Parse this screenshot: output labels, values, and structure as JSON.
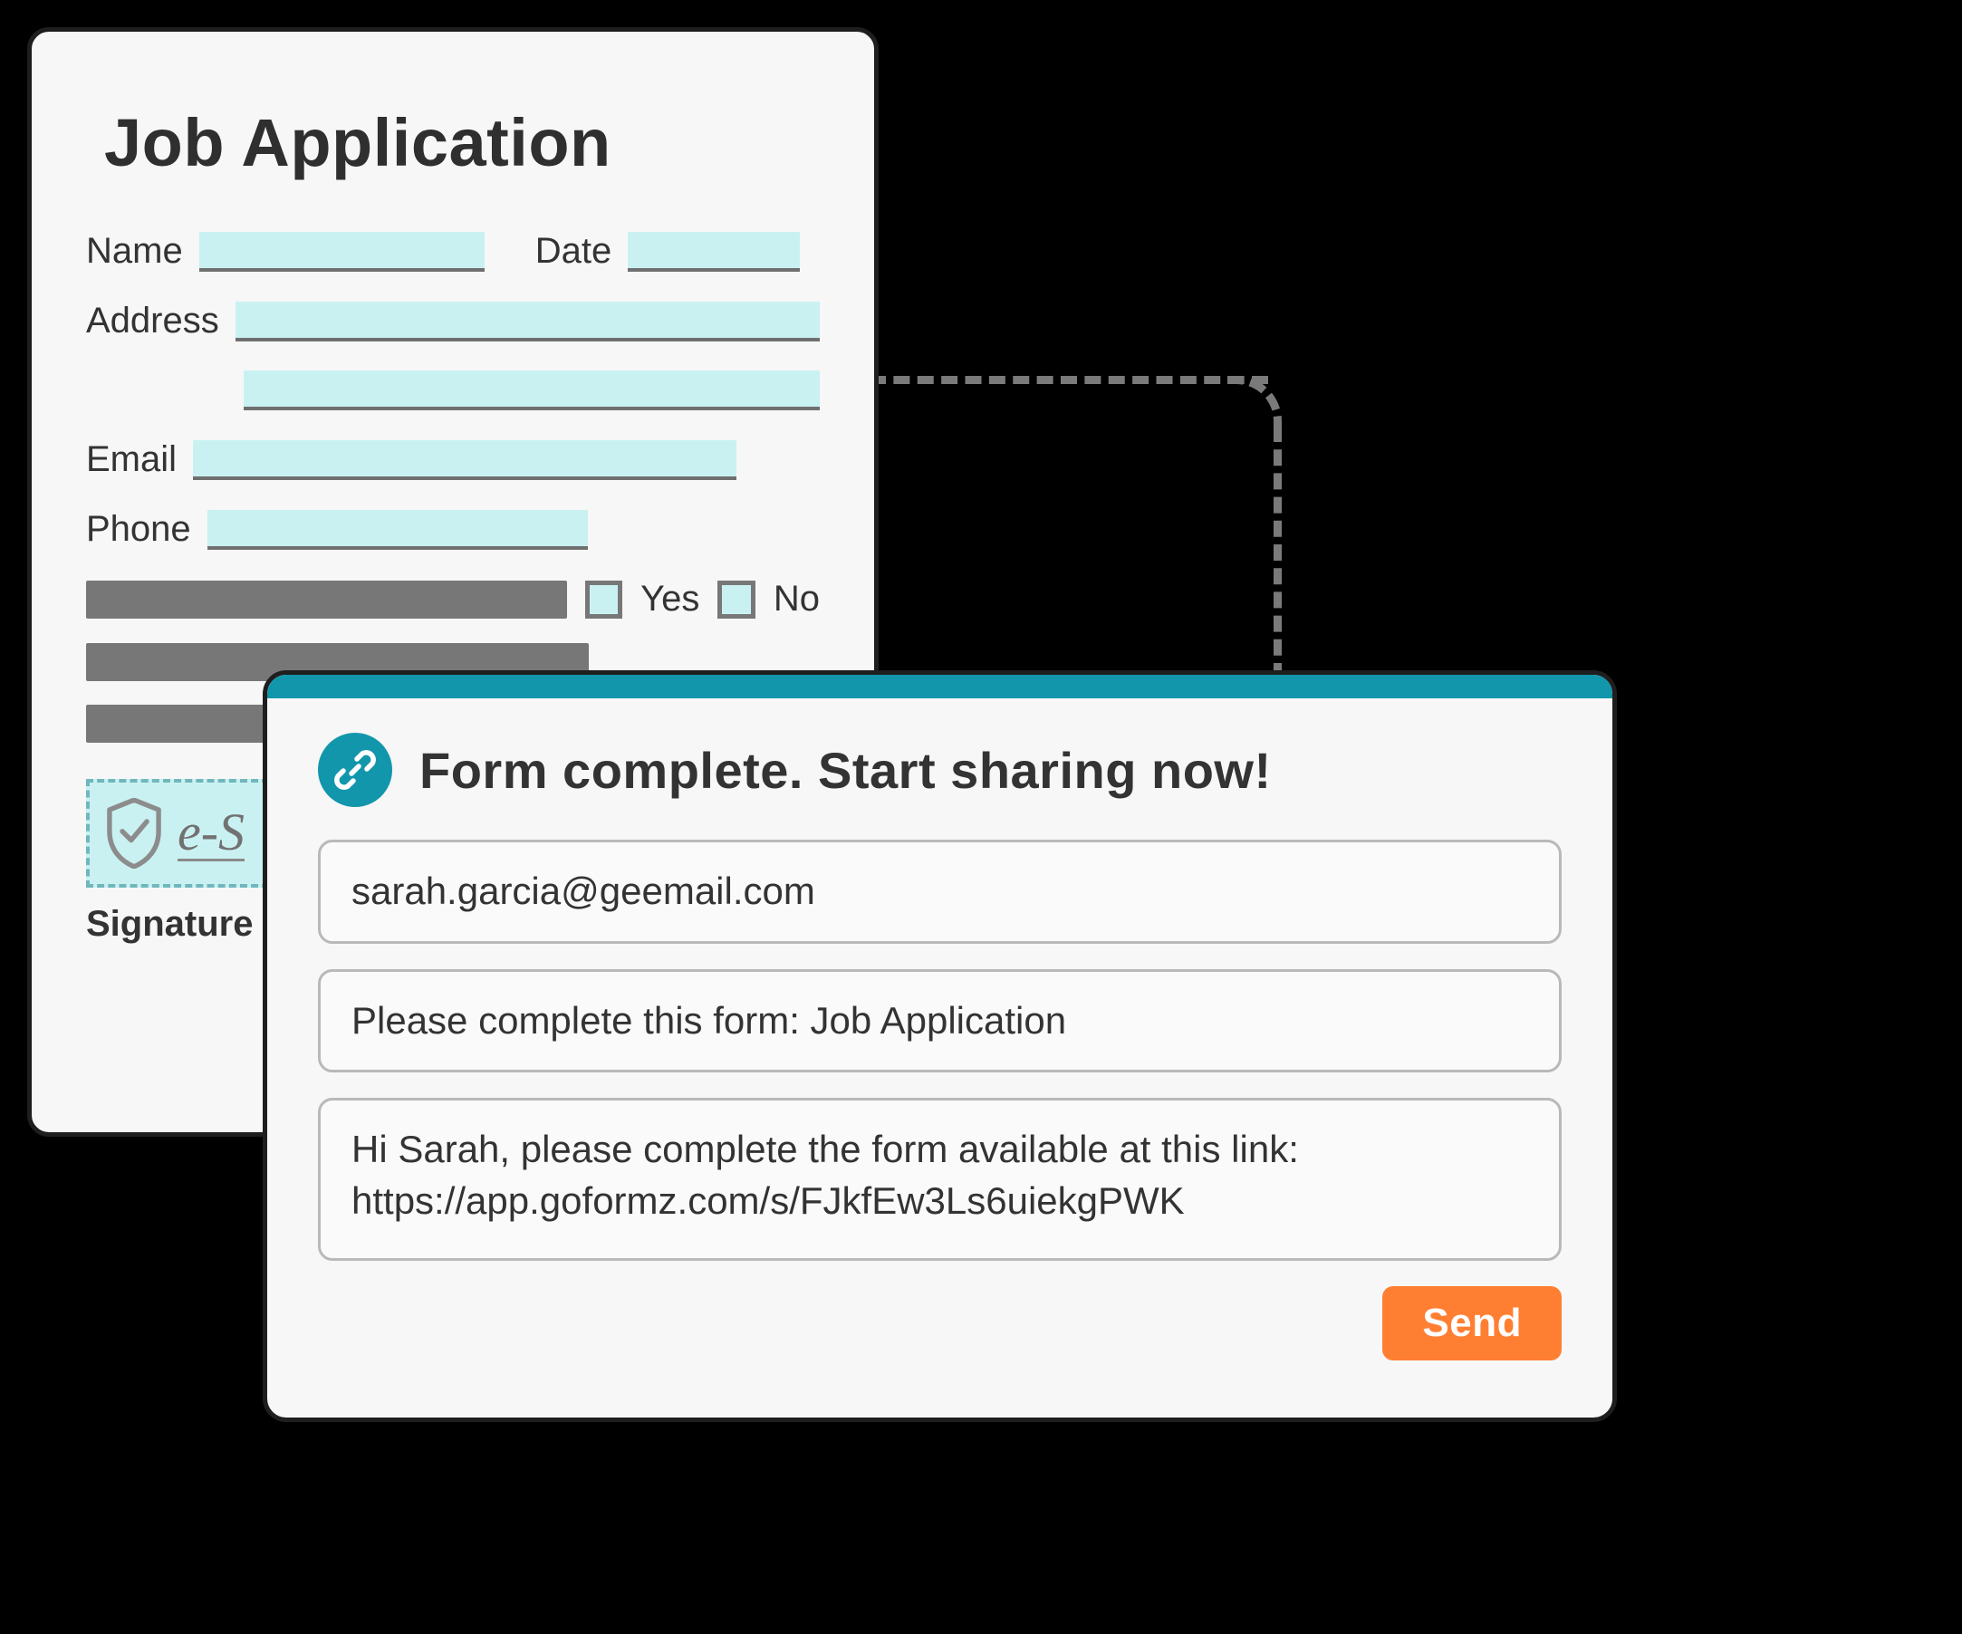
{
  "form": {
    "title": "Job Application",
    "fields": {
      "name_label": "Name",
      "date_label": "Date",
      "address_label": "Address",
      "email_label": "Email",
      "phone_label": "Phone"
    },
    "yes_no": {
      "yes_label": "Yes",
      "no_label": "No"
    },
    "signature": {
      "placeholder_script": "e-S",
      "label": "Signature"
    }
  },
  "share_modal": {
    "title": "Form complete. Start sharing now!",
    "recipient": "sarah.garcia@geemail.com",
    "subject": "Please complete this form: Job Application",
    "message": "Hi Sarah, please complete the form available at this link: https://app.goformz.com/s/FJkfEw3Ls6uiekgPWK",
    "send_label": "Send"
  },
  "colors": {
    "field_fill": "#caf1f2",
    "accent": "#1296ab",
    "send_button": "#ff7f32"
  }
}
